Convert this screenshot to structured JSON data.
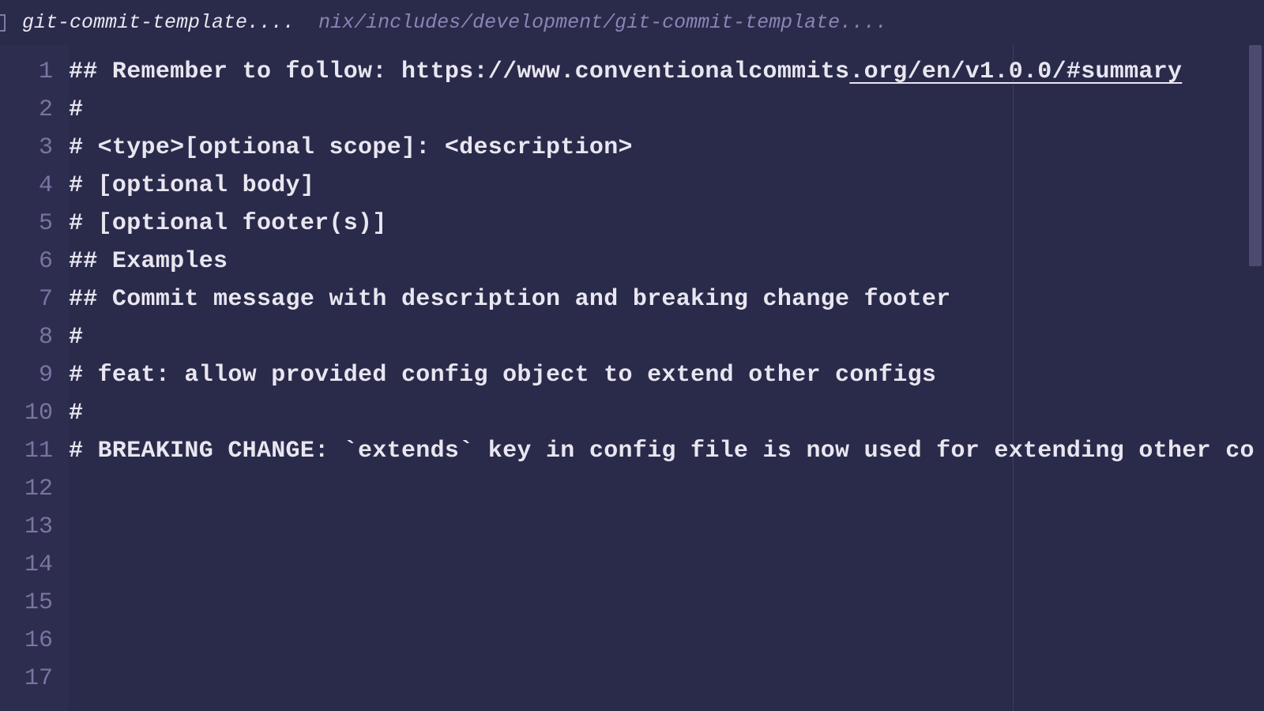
{
  "tab": {
    "title": "git-commit-template....",
    "path": "nix/includes/development/git-commit-template...."
  },
  "editor": {
    "lines": [
      {
        "num": "1",
        "text": ""
      },
      {
        "num": "2",
        "text": ""
      },
      {
        "num": "3",
        "text": ""
      },
      {
        "num": "4",
        "text": "## Remember to follow: https://www.conventionalcommits",
        "linkPart": ".org/en/v1.0.0/#summary"
      },
      {
        "num": "5",
        "text": "#"
      },
      {
        "num": "6",
        "text": "# <type>[optional scope]: <description>"
      },
      {
        "num": "7",
        "text": ""
      },
      {
        "num": "8",
        "text": "# [optional body]"
      },
      {
        "num": "9",
        "text": ""
      },
      {
        "num": "10",
        "text": "# [optional footer(s)]"
      },
      {
        "num": "11",
        "text": ""
      },
      {
        "num": "12",
        "text": "## Examples"
      },
      {
        "num": "13",
        "text": "## Commit message with description and breaking change footer"
      },
      {
        "num": "14",
        "text": "#"
      },
      {
        "num": "15",
        "text": "# feat: allow provided config object to extend other configs"
      },
      {
        "num": "16",
        "text": "#"
      },
      {
        "num": "17",
        "text": "# BREAKING CHANGE: `extends` key in config file is now used for extending other co"
      }
    ]
  }
}
